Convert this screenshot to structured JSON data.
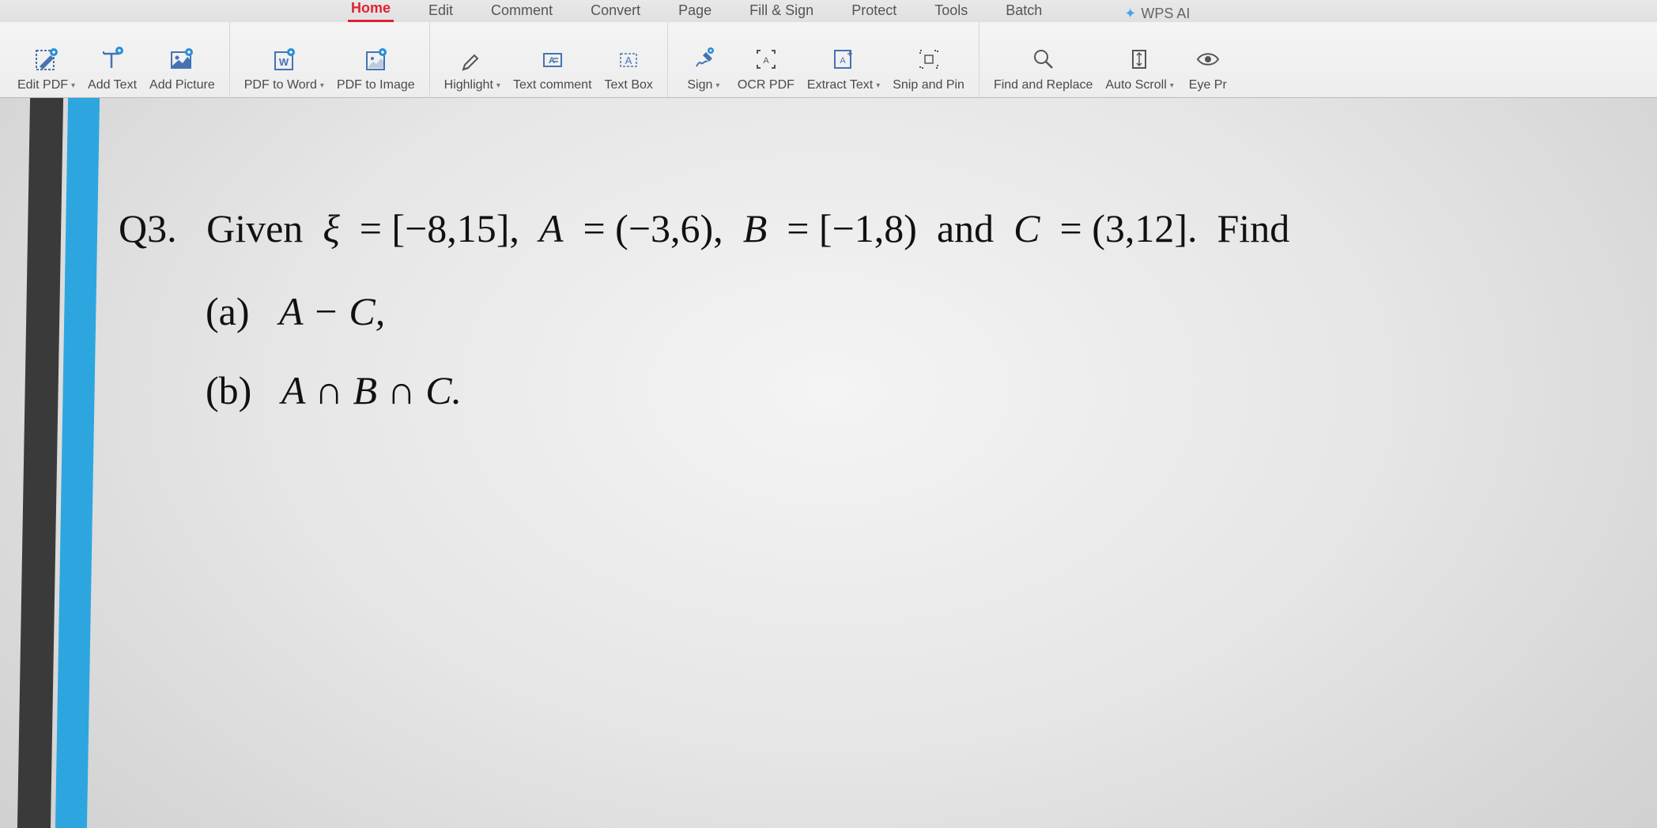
{
  "tabs": {
    "home": "Home",
    "edit": "Edit",
    "comment": "Comment",
    "convert": "Convert",
    "page": "Page",
    "fillsign": "Fill & Sign",
    "protect": "Protect",
    "tools": "Tools",
    "batch": "Batch",
    "wpsai": "WPS AI"
  },
  "ribbon": {
    "edit_pdf": "Edit PDF",
    "add_text": "Add Text",
    "add_picture": "Add Picture",
    "pdf_to_word": "PDF to Word",
    "pdf_to_image": "PDF to Image",
    "highlight": "Highlight",
    "text_comment": "Text comment",
    "text_box": "Text Box",
    "sign": "Sign",
    "ocr_pdf": "OCR PDF",
    "extract_text": "Extract Text",
    "snip_pin": "Snip and Pin",
    "find_replace": "Find and Replace",
    "auto_scroll": "Auto Scroll",
    "eye_pr": "Eye Pr"
  },
  "doc": {
    "q_label": "Q3.",
    "given": "Given",
    "xi": "ξ",
    "eq_xi": "= [−8,15],",
    "A": "A",
    "eq_A": "= (−3,6),",
    "B": "B",
    "eq_B": "= [−1,8)",
    "and": "and",
    "C": "C",
    "eq_C": "= (3,12].",
    "find": "Find",
    "part_a_label": "(a)",
    "part_a_body": "A − C,",
    "part_b_label": "(b)",
    "part_b_body": "A ∩ B ∩ C."
  }
}
